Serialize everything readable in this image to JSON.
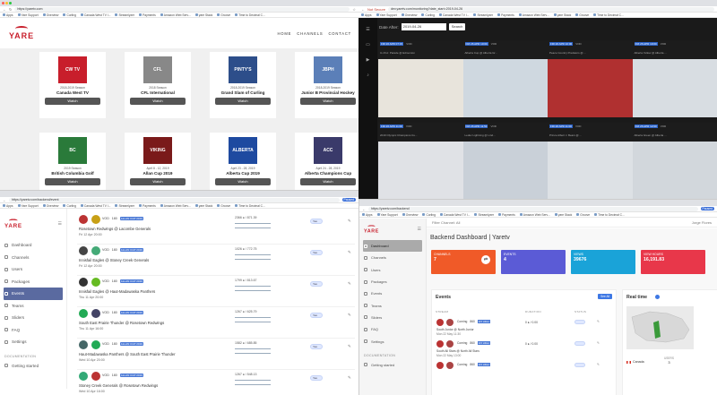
{
  "bookmarks": [
    "Apps",
    "Yare Support",
    "Overview",
    "Curling",
    "Canada West TV I...",
    "Streamlyzer",
    "Payments",
    "Amazon Web Serv...",
    "yare Stack",
    "Groove",
    "Time to Decimal C..."
  ],
  "bookmarks_short": [
    "Apps",
    "Yare Support",
    "Overview",
    "Curling",
    "Canada West TV I...",
    "Streamlyzer",
    "Payments",
    "Amazon Web Serv...",
    "yare Stack",
    "Groove",
    "Time to Decimal C..."
  ],
  "w1": {
    "url": "https://yaretv.com",
    "logo": "YARE",
    "nav": [
      "HOME",
      "CHANNELS",
      "CONTACT"
    ],
    "cards": [
      {
        "icon_text": "CW TV",
        "color": "#c81e2b",
        "sub": "2018-2019 Season",
        "name": "Canada West TV",
        "btn": "Watch"
      },
      {
        "icon_text": "CFL",
        "color": "#888888",
        "sub": "2018 Season",
        "name": "CFL International",
        "btn": "Watch"
      },
      {
        "icon_text": "PINTY'S",
        "color": "#2d4e8a",
        "sub": "2018-2019 Season",
        "name": "Grand Slam of Curling",
        "btn": "Watch"
      },
      {
        "icon_text": "JBPH",
        "color": "#5b7fb8",
        "sub": "2018-2019 Season",
        "name": "Junior B Provincial Hockey",
        "btn": "Watch"
      },
      {
        "icon_text": "BC",
        "color": "#2a7a3a",
        "sub": "2019 Season",
        "name": "British Columbia Golf",
        "btn": "Watch"
      },
      {
        "icon_text": "VIKING",
        "color": "#7a1a1a",
        "sub": "April 8 - 12, 2019",
        "name": "Allan Cup 2019",
        "btn": "Watch"
      },
      {
        "icon_text": "ALBERTA",
        "color": "#1e4aa0",
        "sub": "April 23 - 28, 2019",
        "name": "Alberta Cup 2019",
        "btn": "Watch"
      },
      {
        "icon_text": "ACC",
        "color": "#3a3a6a",
        "sub": "April 24 - 28, 2019",
        "name": "Alberta Champions Cup",
        "btn": "Watch"
      }
    ]
  },
  "w2": {
    "warning": "Not Secure",
    "url": "dev.yaretv.com/monitoring?date_start=2019-04-26",
    "date_label": "Date After:",
    "date_value": "2019-04-26",
    "search": "Search",
    "tiles": [
      {
        "date": "FRI 26 APR 07:15",
        "status": "VOD",
        "line": "U-16 A: Parade @ Edmonton",
        "color": "#e8e4dc"
      },
      {
        "date": "FRI 26 APR 10:00",
        "status": "VOD",
        "line": "Alberta Cup @ Alberta Gr...",
        "color": "#cfd8e0"
      },
      {
        "date": "FRI 26 APR 10:00",
        "status": "VOD",
        "line": "Peace Country Predators @ ...",
        "color": "#b03030"
      },
      {
        "date": "FRI 26 APR 10:00",
        "status": "VOD",
        "line": "Alberta Yellow @ Alberta ...",
        "color": "#d8dde2"
      },
      {
        "date": "FRI 26 APR 11:00",
        "status": "VOD",
        "line": "2019 Olympic Champions Cu...",
        "color": "#e0e2e6"
      },
      {
        "date": "FRI 26 APR 11:50",
        "status": "VOD",
        "line": "Leduc Lightning @ Lind...",
        "color": "#c9d0d8"
      },
      {
        "date": "FRI 26 APR 11:00",
        "status": "VOD",
        "line": "Prince Albert J. Bears @ ...",
        "color": "#dde1e5"
      },
      {
        "date": "FRI 26 APR 12:00",
        "status": "VOD",
        "line": "Alberta Green @ Alberta ...",
        "color": "#d2d7dc"
      }
    ]
  },
  "w3": {
    "url": "https://yaretv.com/backend/event",
    "status": "Paused",
    "nav": [
      "Dashboard",
      "Channels",
      "Users",
      "Packages",
      "Events",
      "Teams",
      "Sliders",
      "FAQ",
      "Settings"
    ],
    "section": "DOCUMENTATION",
    "getting_started": "Getting started",
    "events": [
      {
        "status": "VOD",
        "views": "180",
        "tag": "ALLAN CUP 2019",
        "title": "Rosetown Redwings @ Lacombe Generals",
        "when": "Fri 12 Apr 20:00",
        "stats": "2366 ● / 871.39",
        "tog": "Yes"
      },
      {
        "status": "VOD",
        "views": "180",
        "tag": "ALLAN CUP 2019",
        "title": "Innisfail Eagles @ Stoney Creek Generals",
        "when": "Fri 12 Apr 20:00",
        "stats": "1026 ● / 772.75",
        "tog": "Yes"
      },
      {
        "status": "VOD",
        "views": "180",
        "tag": "ALLAN CUP 2019",
        "title": "Innisfail Eagles @ Haut-Madawaska Panthers",
        "when": "Thu 11 Apr 20:00",
        "stats": "1799 ● / 813.67",
        "tog": "Yes"
      },
      {
        "status": "VOD",
        "views": "180",
        "tag": "ALLAN CUP 2019",
        "title": "South East Prairie Thunder @ Rosetown Redwings",
        "when": "Thu 11 Apr 16:00",
        "stats": "1267 ● / 625.79",
        "tog": "Yes"
      },
      {
        "status": "VOD",
        "views": "180",
        "tag": "ALLAN CUP 2019",
        "title": "Haut-Madawaska Panthers @ South East Prairie Thunder",
        "when": "Wed 10 Apr 20:00",
        "stats": "1582 ● / 685.85",
        "tog": "Yes"
      },
      {
        "status": "VOD",
        "views": "180",
        "tag": "ALLAN CUP 2019",
        "title": "Stoney Creek Generals @ Rosetown Redwings",
        "when": "Wed 10 Apr 16:00",
        "stats": "1267 ● / 548.13",
        "tog": "Yes"
      }
    ]
  },
  "w4": {
    "url": "https://yaretv.com/backend",
    "status": "Paused",
    "filter": "Filter Channel:",
    "filter_value": "All",
    "user": "Jorge Flores",
    "title": "Backend Dashboard | Yaretv",
    "nav": [
      "Dashboard",
      "Channels",
      "Users",
      "Packages",
      "Events",
      "Teams",
      "Sliders",
      "FAQ",
      "Settings"
    ],
    "section": "DOCUMENTATION",
    "getting_started": "Getting started",
    "kpis": [
      {
        "label": "CHANNELS",
        "value": "7",
        "color": "#f05a28",
        "icon": "⇄"
      },
      {
        "label": "EVENTS",
        "value": "4",
        "color": "#5b5bd6",
        "icon": ""
      },
      {
        "label": "VIEWS",
        "value": "39676",
        "color": "#1aa3d8",
        "icon": ""
      },
      {
        "label": "VIEW HOURS",
        "value": "16,191.83",
        "color": "#e8374a",
        "icon": ""
      }
    ],
    "events_title": "Events",
    "see_all": "See All",
    "thead": [
      "STREAM",
      "DURATION",
      "STATUS"
    ],
    "events": [
      {
        "status": "Coming",
        "views": "860",
        "tag": "WJ HIGH",
        "title": "South Junior @ North Junior",
        "when": "Mon 22 May 11:30",
        "dur": "0 ● / 0.00"
      },
      {
        "status": "Coming",
        "views": "860",
        "tag": "WJ HIGH",
        "title": "South All Stars @ North All Stars",
        "when": "Mon 22 May 13:00",
        "dur": "0 ● / 0.00"
      },
      {
        "status": "Coming",
        "views": "860",
        "tag": "WJ HIGH",
        "title": "",
        "when": "",
        "dur": ""
      }
    ],
    "realtime_title": "Real time",
    "country": "Canada",
    "users_label": "USERS",
    "users_value": "3"
  }
}
